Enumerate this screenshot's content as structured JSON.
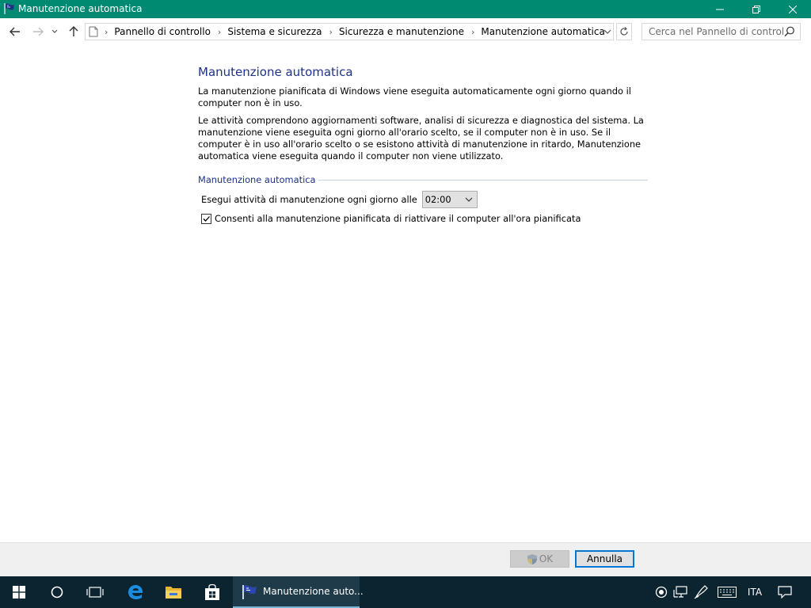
{
  "window": {
    "title": "Manutenzione automatica",
    "icon": "flag-icon"
  },
  "nav": {
    "back_icon": "arrow-left-icon",
    "forward_icon": "arrow-right-icon",
    "recent_icon": "chevron-down-icon",
    "up_icon": "arrow-up-icon"
  },
  "address": {
    "crumbs": [
      "Pannello di controllo",
      "Sistema e sicurezza",
      "Sicurezza e manutenzione",
      "Manutenzione automatica"
    ]
  },
  "search": {
    "placeholder": "Cerca nel Pannello di controllo"
  },
  "content": {
    "heading": "Manutenzione automatica",
    "para1": "La manutenzione pianificata di Windows viene eseguita automaticamente ogni giorno quando il computer non è in uso.",
    "para2": "Le attività comprendono aggiornamenti software, analisi di sicurezza e diagnostica del sistema. La manutenzione viene eseguita ogni giorno all'orario scelto, se il computer non è in uso. Se il computer è in uso all'orario scelto o se esistono attività di manutenzione in ritardo, Manutenzione automatica viene eseguita quando il computer non viene utilizzato.",
    "group_title": "Manutenzione automatica",
    "time_label": "Esegui attività di manutenzione ogni giorno alle",
    "time_value": "02:00",
    "wake_label": "Consenti alla manutenzione pianificata di riattivare il computer all'ora pianificata",
    "wake_checked": true
  },
  "footer": {
    "ok_label": "OK",
    "cancel_label": "Annulla"
  },
  "taskbar": {
    "active_app_label": "Manutenzione auto...",
    "language": "ITA"
  },
  "colors": {
    "titlebar": "#008a72",
    "heading": "#1e3287",
    "taskbar": "#0c2330",
    "focus": "#0078d7"
  }
}
